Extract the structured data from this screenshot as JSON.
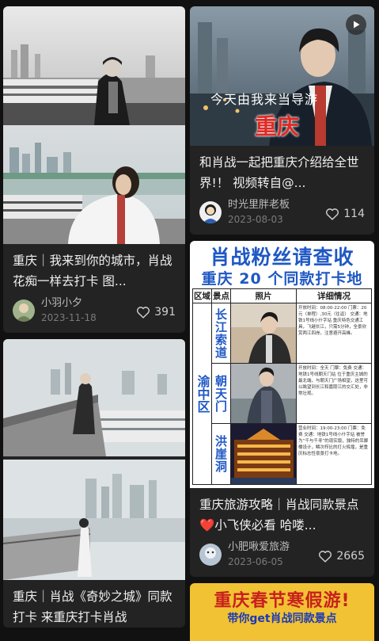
{
  "feed": {
    "left": [
      {
        "title": "重庆｜我来到你的城市，肖战 花痴一样去打卡 图...",
        "author": "小羽小夕",
        "date": "2023-11-18",
        "likes": "391"
      },
      {
        "title": "重庆｜肖战《奇妙之城》同款打卡 来重庆打卡肖战",
        "author": "",
        "date": "",
        "likes": ""
      }
    ],
    "right": [
      {
        "title": "和肖战一起把重庆介绍给全世界!！ 视频转自@...",
        "author": "时光里胖老板",
        "date": "2023-08-03",
        "likes": "114",
        "overlay_caption": "今天由我来当导游",
        "overlay_city": "重庆"
      },
      {
        "title": "重庆旅游攻略｜肖战同款景点❤️小飞侠必看 哈喽...",
        "author": "小肥啾爱旅游",
        "date": "2023-06-05",
        "likes": "2665",
        "poster": {
          "title": "肖战粉丝请查收",
          "subtitle": "重庆 20 个同款打卡地",
          "headers": [
            "区域",
            "景点",
            "照片",
            "详细情况"
          ],
          "region": "渝中区",
          "rows": [
            {
              "spot": "长江索道",
              "detail": "开放时间：08:00-22:00 门票：20元（单程）,30元（往返） 交通：地铁1号线小什字站 重庆特色交通工具，飞越长江，只需5分钟，全景欣赏两江四岸。注意避开高峰。"
            },
            {
              "spot": "朝天门",
              "detail": "开放时间：全天 门票：免费 交通：地铁1号线朝天门站 位于重庆主城的最北端，与朝天门广场相望，这里可以眺望到长江和嘉陵江的交汇处，非常壮观。"
            },
            {
              "spot": "洪崖洞",
              "detail": "营业时间：19:00-23:00 门票：免费 交通：地铁1号线小什字站 被誉为“千与千寻”的现实版，独特的吊脚楼设计，鳞次栉比的灯火辉煌，是重庆标志性夜景打卡地。"
            }
          ]
        }
      },
      {
        "banner_title": "重庆春节寒假游!",
        "banner_sub": "带你get肖战同款景点"
      }
    ]
  },
  "colors": {
    "background": "#111111",
    "card": "#232323",
    "poster_blue": "#1f58c4",
    "city_red": "#e02a24"
  }
}
